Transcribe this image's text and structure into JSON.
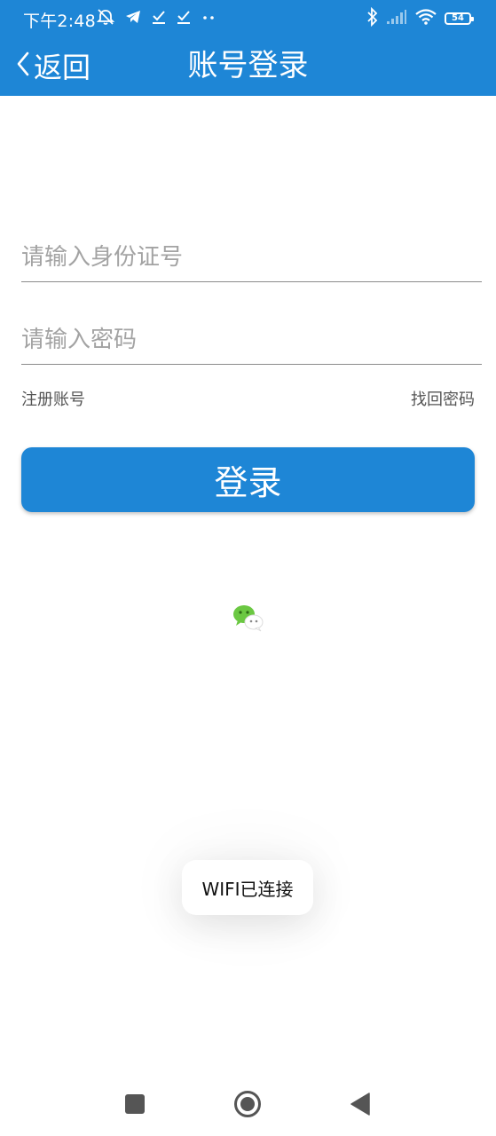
{
  "status_bar": {
    "time": "下午2:48",
    "battery": "54",
    "icons": [
      "alarm-off-icon",
      "telegram-icon",
      "check-icon",
      "check-icon",
      "more-dots-icon",
      "bluetooth-icon",
      "signal-icon",
      "wifi-icon",
      "battery-icon"
    ]
  },
  "header": {
    "back_label": "返回",
    "title": "账号登录"
  },
  "form": {
    "id_placeholder": "请输入身份证号",
    "password_placeholder": "请输入密码",
    "register_label": "注册账号",
    "forgot_label": "找回密码",
    "login_label": "登录"
  },
  "social": {
    "icon": "wechat-icon"
  },
  "toast": {
    "message": "WIFI已连接"
  },
  "system_nav": {
    "icons": [
      "recent-apps-icon",
      "home-icon",
      "back-triangle-icon"
    ]
  },
  "colors": {
    "primary": "#1e86d6",
    "background": "#ffffff",
    "placeholder": "#a3a3a3",
    "wechat_green": "#6bc842"
  }
}
